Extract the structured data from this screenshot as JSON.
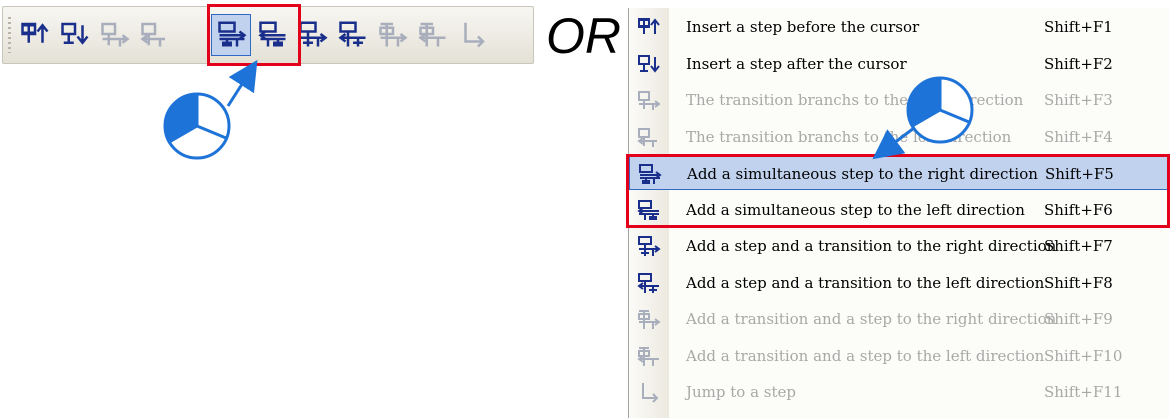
{
  "or_text": "OR",
  "toolbar": {
    "buttons": [
      {
        "icon": "insert-step-before-icon",
        "enabled": true,
        "active": false
      },
      {
        "icon": "insert-step-after-icon",
        "enabled": true,
        "active": false
      },
      {
        "icon": "transition-branch-right-icon",
        "enabled": false,
        "active": false
      },
      {
        "icon": "transition-branch-left-icon",
        "enabled": false,
        "active": false
      },
      {
        "icon": "simultaneous-step-right-icon",
        "enabled": true,
        "active": true
      },
      {
        "icon": "simultaneous-step-left-icon",
        "enabled": true,
        "active": false
      },
      {
        "icon": "step-transition-right-icon",
        "enabled": true,
        "active": false
      },
      {
        "icon": "step-transition-left-icon",
        "enabled": true,
        "active": false
      },
      {
        "icon": "transition-step-right-icon",
        "enabled": false,
        "active": false
      },
      {
        "icon": "transition-step-left-icon",
        "enabled": false,
        "active": false
      },
      {
        "icon": "jump-to-step-icon",
        "enabled": false,
        "active": false
      }
    ]
  },
  "menu": {
    "items": [
      {
        "label": "Insert a step before the cursor",
        "shortcut": "Shift+F1",
        "icon": "insert-step-before-icon",
        "enabled": true,
        "selected": false
      },
      {
        "label": "Insert a step after the cursor",
        "shortcut": "Shift+F2",
        "icon": "insert-step-after-icon",
        "enabled": true,
        "selected": false
      },
      {
        "label": "The transition branchs to the right direction",
        "shortcut": "Shift+F3",
        "icon": "transition-branch-right-icon",
        "enabled": false,
        "selected": false
      },
      {
        "label": "The transition branchs to the left direction",
        "shortcut": "Shift+F4",
        "icon": "transition-branch-left-icon",
        "enabled": false,
        "selected": false
      },
      {
        "label": "Add a simultaneous step to the right direction",
        "shortcut": "Shift+F5",
        "icon": "simultaneous-step-right-icon",
        "enabled": true,
        "selected": true
      },
      {
        "label": "Add a simultaneous step to the left direction",
        "shortcut": "Shift+F6",
        "icon": "simultaneous-step-left-icon",
        "enabled": true,
        "selected": false
      },
      {
        "label": "Add a step and a transition to the right direction",
        "shortcut": "Shift+F7",
        "icon": "step-transition-right-icon",
        "enabled": true,
        "selected": false
      },
      {
        "label": "Add a step and a transition to the left direction",
        "shortcut": "Shift+F8",
        "icon": "step-transition-left-icon",
        "enabled": true,
        "selected": false
      },
      {
        "label": "Add a transition and a step to the right direction",
        "shortcut": "Shift+F9",
        "icon": "transition-step-right-icon",
        "enabled": false,
        "selected": false
      },
      {
        "label": "Add a transition and a step to the left direction",
        "shortcut": "Shift+F10",
        "icon": "transition-step-left-icon",
        "enabled": false,
        "selected": false
      },
      {
        "label": "Jump to a step",
        "shortcut": "Shift+F11",
        "icon": "jump-to-step-icon",
        "enabled": false,
        "selected": false
      }
    ]
  },
  "colors": {
    "enabled_icon": "#1a2f8c",
    "disabled_icon": "#a9aebd",
    "highlight_red": "#e2001a",
    "callout_blue": "#1e73d8",
    "selection_fill": "#c1d2ee",
    "selection_border": "#316ac5",
    "disabled_text": "#a8a8a8"
  }
}
